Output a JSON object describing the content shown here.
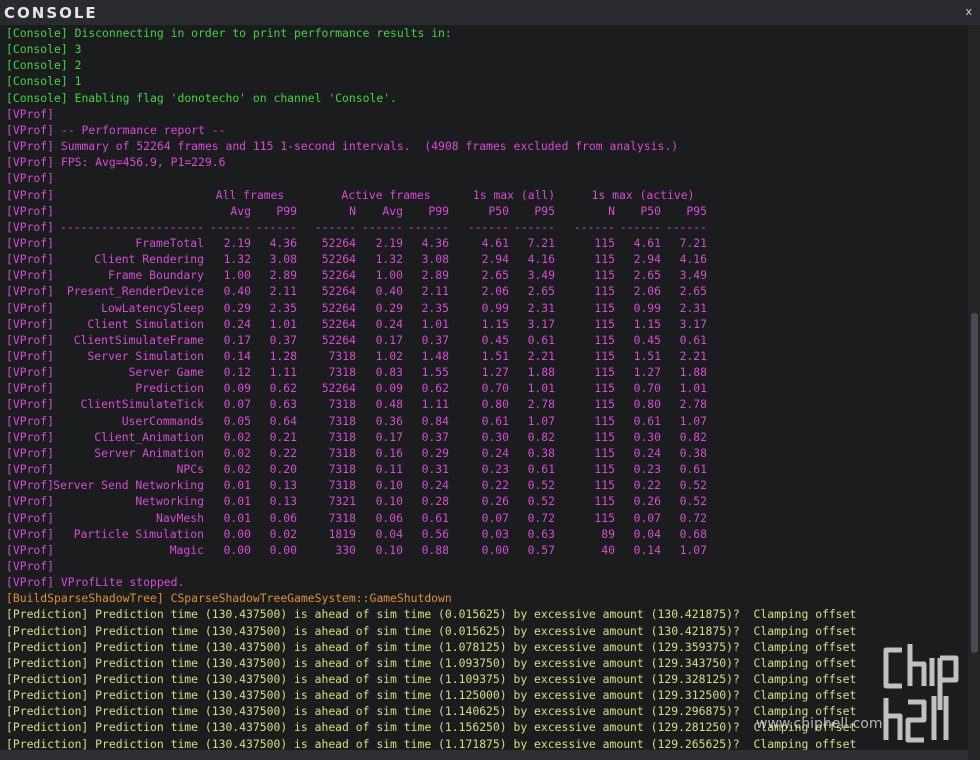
{
  "window": {
    "title": "CONSOLE",
    "close_label": "x"
  },
  "colors": {
    "console_green": "#44d43e",
    "vprof_magenta": "#d94ad8",
    "build_orange": "#e0902e",
    "prediction_yellow": "#cfe17e",
    "background": "#1b1c1e"
  },
  "icons": {
    "close": "close-icon",
    "watermark": "chiphell-logo-icon"
  },
  "header_lines": [
    {
      "tag": "[Console]",
      "text": " Disconnecting in order to print performance results in:",
      "color": "console_green"
    },
    {
      "tag": "[Console]",
      "text": " 3",
      "color": "console_green"
    },
    {
      "tag": "[Console]",
      "text": " 2",
      "color": "console_green"
    },
    {
      "tag": "[Console]",
      "text": " 1",
      "color": "console_green"
    },
    {
      "tag": "[Console]",
      "text": " Enabling flag 'donotecho' on channel 'Console'.",
      "color": "console_green"
    },
    {
      "tag": "[VProf]",
      "text": "",
      "color": "vprof_magenta"
    },
    {
      "tag": "[VProf]",
      "text": " -- Performance report --",
      "color": "vprof_magenta"
    },
    {
      "tag": "[VProf]",
      "text": " Summary of 52264 frames and 115 1-second intervals.  (4908 frames excluded from analysis.)",
      "color": "vprof_magenta"
    },
    {
      "tag": "[VProf]",
      "text": " FPS: Avg=456.9, P1=229.6",
      "color": "vprof_magenta"
    },
    {
      "tag": "[VProf]",
      "text": "",
      "color": "vprof_magenta"
    }
  ],
  "perf_table": {
    "tag": "[VProf]",
    "group_headers": [
      "All frames",
      "Active frames",
      "1s max (all)",
      "1s max (active)"
    ],
    "columns": [
      "Avg",
      "P99",
      "N",
      "Avg",
      "P99",
      "P50",
      "P95",
      "N",
      "P50",
      "P95"
    ],
    "separators": [
      "---------------------",
      "------",
      "------",
      "------",
      "------",
      "------",
      "------",
      "------",
      "------",
      "------",
      "------"
    ],
    "rows": [
      {
        "name": "FrameTotal",
        "values": [
          "2.19",
          "4.36",
          "52264",
          "2.19",
          "4.36",
          "4.61",
          "7.21",
          "115",
          "4.61",
          "7.21"
        ]
      },
      {
        "name": "Client Rendering",
        "values": [
          "1.32",
          "3.08",
          "52264",
          "1.32",
          "3.08",
          "2.94",
          "4.16",
          "115",
          "2.94",
          "4.16"
        ]
      },
      {
        "name": "Frame Boundary",
        "values": [
          "1.00",
          "2.89",
          "52264",
          "1.00",
          "2.89",
          "2.65",
          "3.49",
          "115",
          "2.65",
          "3.49"
        ]
      },
      {
        "name": "Present_RenderDevice",
        "values": [
          "0.40",
          "2.11",
          "52264",
          "0.40",
          "2.11",
          "2.06",
          "2.65",
          "115",
          "2.06",
          "2.65"
        ]
      },
      {
        "name": "LowLatencySleep",
        "values": [
          "0.29",
          "2.35",
          "52264",
          "0.29",
          "2.35",
          "0.99",
          "2.31",
          "115",
          "0.99",
          "2.31"
        ]
      },
      {
        "name": "Client Simulation",
        "values": [
          "0.24",
          "1.01",
          "52264",
          "0.24",
          "1.01",
          "1.15",
          "3.17",
          "115",
          "1.15",
          "3.17"
        ]
      },
      {
        "name": "ClientSimulateFrame",
        "values": [
          "0.17",
          "0.37",
          "52264",
          "0.17",
          "0.37",
          "0.45",
          "0.61",
          "115",
          "0.45",
          "0.61"
        ]
      },
      {
        "name": "Server Simulation",
        "values": [
          "0.14",
          "1.28",
          "7318",
          "1.02",
          "1.48",
          "1.51",
          "2.21",
          "115",
          "1.51",
          "2.21"
        ]
      },
      {
        "name": "Server Game",
        "values": [
          "0.12",
          "1.11",
          "7318",
          "0.83",
          "1.55",
          "1.27",
          "1.88",
          "115",
          "1.27",
          "1.88"
        ]
      },
      {
        "name": "Prediction",
        "values": [
          "0.09",
          "0.62",
          "52264",
          "0.09",
          "0.62",
          "0.70",
          "1.01",
          "115",
          "0.70",
          "1.01"
        ]
      },
      {
        "name": "ClientSimulateTick",
        "values": [
          "0.07",
          "0.63",
          "7318",
          "0.48",
          "1.11",
          "0.80",
          "2.78",
          "115",
          "0.80",
          "2.78"
        ]
      },
      {
        "name": "UserCommands",
        "values": [
          "0.05",
          "0.64",
          "7318",
          "0.36",
          "0.84",
          "0.61",
          "1.07",
          "115",
          "0.61",
          "1.07"
        ]
      },
      {
        "name": "Client_Animation",
        "values": [
          "0.02",
          "0.21",
          "7318",
          "0.17",
          "0.37",
          "0.30",
          "0.82",
          "115",
          "0.30",
          "0.82"
        ]
      },
      {
        "name": "Server Animation",
        "values": [
          "0.02",
          "0.22",
          "7318",
          "0.16",
          "0.29",
          "0.24",
          "0.38",
          "115",
          "0.24",
          "0.38"
        ]
      },
      {
        "name": "NPCs",
        "values": [
          "0.02",
          "0.20",
          "7318",
          "0.11",
          "0.31",
          "0.23",
          "0.61",
          "115",
          "0.23",
          "0.61"
        ]
      },
      {
        "name": "Server Send Networking",
        "values": [
          "0.01",
          "0.13",
          "7318",
          "0.10",
          "0.24",
          "0.22",
          "0.52",
          "115",
          "0.22",
          "0.52"
        ]
      },
      {
        "name": "Networking",
        "values": [
          "0.01",
          "0.13",
          "7321",
          "0.10",
          "0.28",
          "0.26",
          "0.52",
          "115",
          "0.26",
          "0.52"
        ]
      },
      {
        "name": "NavMesh",
        "values": [
          "0.01",
          "0.06",
          "7318",
          "0.06",
          "0.61",
          "0.07",
          "0.72",
          "115",
          "0.07",
          "0.72"
        ]
      },
      {
        "name": "Particle Simulation",
        "values": [
          "0.00",
          "0.02",
          "1819",
          "0.04",
          "0.56",
          "0.03",
          "0.63",
          "89",
          "0.04",
          "0.68"
        ]
      },
      {
        "name": "Magic",
        "values": [
          "0.00",
          "0.00",
          "330",
          "0.10",
          "0.88",
          "0.00",
          "0.57",
          "40",
          "0.14",
          "1.07"
        ]
      }
    ]
  },
  "footer_lines": [
    {
      "tag": "[VProf]",
      "text": "",
      "color": "vprof_magenta"
    },
    {
      "tag": "[VProf]",
      "text": " VProfLite stopped.",
      "color": "vprof_magenta"
    },
    {
      "tag": "[BuildSparseShadowTree]",
      "text": " CSparseShadowTreeGameSystem::GameShutdown",
      "color": "build_orange"
    },
    {
      "tag": "[Prediction]",
      "text": " Prediction time (130.437500) is ahead of sim time (0.015625) by excessive amount (130.421875)?  Clamping offset",
      "color": "prediction_yellow"
    },
    {
      "tag": "[Prediction]",
      "text": " Prediction time (130.437500) is ahead of sim time (0.015625) by excessive amount (130.421875)?  Clamping offset",
      "color": "prediction_yellow"
    },
    {
      "tag": "[Prediction]",
      "text": " Prediction time (130.437500) is ahead of sim time (1.078125) by excessive amount (129.359375)?  Clamping offset",
      "color": "prediction_yellow"
    },
    {
      "tag": "[Prediction]",
      "text": " Prediction time (130.437500) is ahead of sim time (1.093750) by excessive amount (129.343750)?  Clamping offset",
      "color": "prediction_yellow"
    },
    {
      "tag": "[Prediction]",
      "text": " Prediction time (130.437500) is ahead of sim time (1.109375) by excessive amount (129.328125)?  Clamping offset",
      "color": "prediction_yellow"
    },
    {
      "tag": "[Prediction]",
      "text": " Prediction time (130.437500) is ahead of sim time (1.125000) by excessive amount (129.312500)?  Clamping offset",
      "color": "prediction_yellow"
    },
    {
      "tag": "[Prediction]",
      "text": " Prediction time (130.437500) is ahead of sim time (1.140625) by excessive amount (129.296875)?  Clamping offset",
      "color": "prediction_yellow"
    },
    {
      "tag": "[Prediction]",
      "text": " Prediction time (130.437500) is ahead of sim time (1.156250) by excessive amount (129.281250)?  Clamping offset",
      "color": "prediction_yellow"
    },
    {
      "tag": "[Prediction]",
      "text": " Prediction time (130.437500) is ahead of sim time (1.171875) by excessive amount (129.265625)?  Clamping offset",
      "color": "prediction_yellow"
    }
  ],
  "watermark": {
    "url": "www.chiphell.com"
  }
}
